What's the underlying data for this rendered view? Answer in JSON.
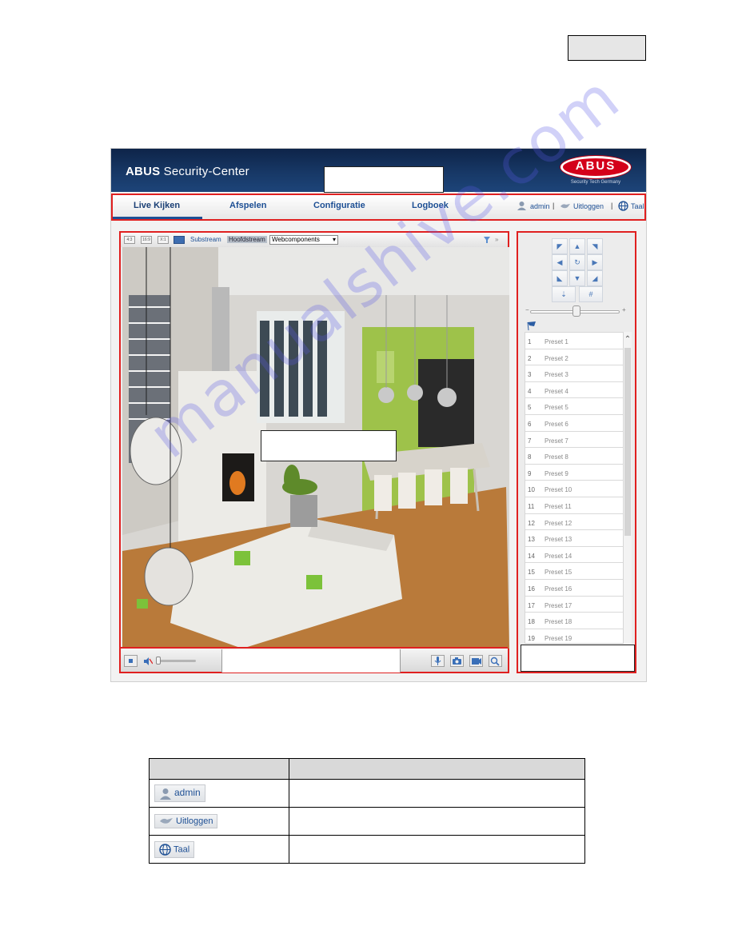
{
  "header": {
    "brand_bold": "ABUS",
    "brand_rest": " Security-Center",
    "logo_text": "ABUS",
    "logo_sub": "Security Tech Germany",
    "brand_color": "#d4001a"
  },
  "nav": {
    "tabs": [
      "Live Kijken",
      "Afspelen",
      "Configuratie",
      "Logboek"
    ],
    "active_tab": "Live Kijken",
    "user": "admin",
    "logout": "Uitloggen",
    "language": "Taal",
    "separator": "|"
  },
  "video_toolbar": {
    "buttons": [
      "4:3",
      "16:9",
      "X:1",
      "fullscreen"
    ],
    "substream": "Substream",
    "mainstream": "Hoofdstream",
    "plugin_select": "Webcomponents",
    "expand": "»"
  },
  "ptz": {
    "slider_minus": "−",
    "slider_plus": "+",
    "presets": [
      {
        "num": "1",
        "label": "Preset 1"
      },
      {
        "num": "2",
        "label": "Preset 2"
      },
      {
        "num": "3",
        "label": "Preset 3"
      },
      {
        "num": "4",
        "label": "Preset 4"
      },
      {
        "num": "5",
        "label": "Preset 5"
      },
      {
        "num": "6",
        "label": "Preset 6"
      },
      {
        "num": "7",
        "label": "Preset 7"
      },
      {
        "num": "8",
        "label": "Preset 8"
      },
      {
        "num": "9",
        "label": "Preset 9"
      },
      {
        "num": "10",
        "label": "Preset 10"
      },
      {
        "num": "11",
        "label": "Preset 11"
      },
      {
        "num": "12",
        "label": "Preset 12"
      },
      {
        "num": "13",
        "label": "Preset 13"
      },
      {
        "num": "14",
        "label": "Preset 14"
      },
      {
        "num": "15",
        "label": "Preset 15"
      },
      {
        "num": "16",
        "label": "Preset 16"
      },
      {
        "num": "17",
        "label": "Preset 17"
      },
      {
        "num": "18",
        "label": "Preset 18"
      },
      {
        "num": "19",
        "label": "Preset 19"
      }
    ]
  },
  "legend": {
    "rows": [
      {
        "label": "admin",
        "icon": "user-icon"
      },
      {
        "label": "Uitloggen",
        "icon": "logout-icon"
      },
      {
        "label": "Taal",
        "icon": "globe-icon"
      }
    ]
  },
  "watermark": "manualshive.com"
}
